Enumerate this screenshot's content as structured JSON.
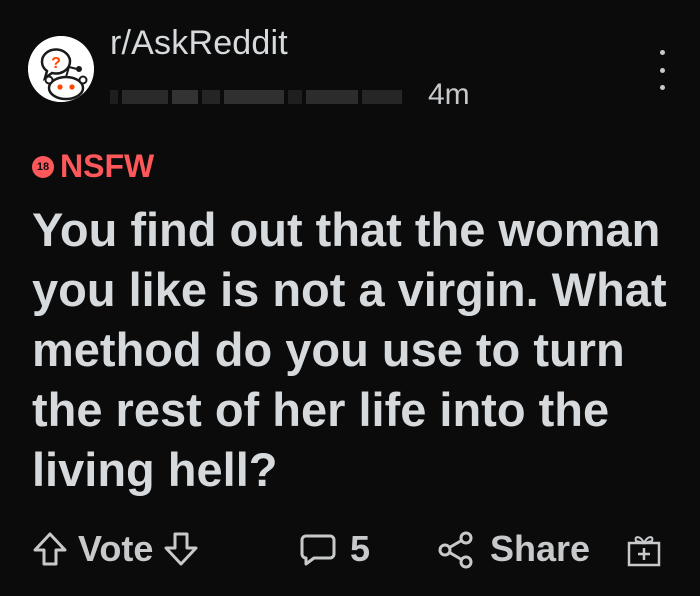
{
  "header": {
    "subreddit": "r/AskReddit",
    "timestamp": "4m",
    "avatar_icon": "askreddit-snoo-icon",
    "menu_icon": "more-vertical-icon"
  },
  "nsfw": {
    "badge_text": "18",
    "label": "NSFW",
    "color": "#ff585b"
  },
  "post": {
    "title": "You find out that the woman you like is not a virgin. What method do you use to turn the rest of her life into the living hell?"
  },
  "footer": {
    "upvote_icon": "arrow-up-icon",
    "vote_label": "Vote",
    "downvote_icon": "arrow-down-icon",
    "comment_icon": "comment-bubble-icon",
    "comment_count": "5",
    "share_icon": "share-nodes-icon",
    "share_label": "Share",
    "award_icon": "gift-award-icon"
  },
  "colors": {
    "background": "#0b0b0b",
    "text": "#d7dadc",
    "muted": "#c7c9cb",
    "accent_orange": "#ff4500",
    "accent_blue": "#0079d3"
  }
}
